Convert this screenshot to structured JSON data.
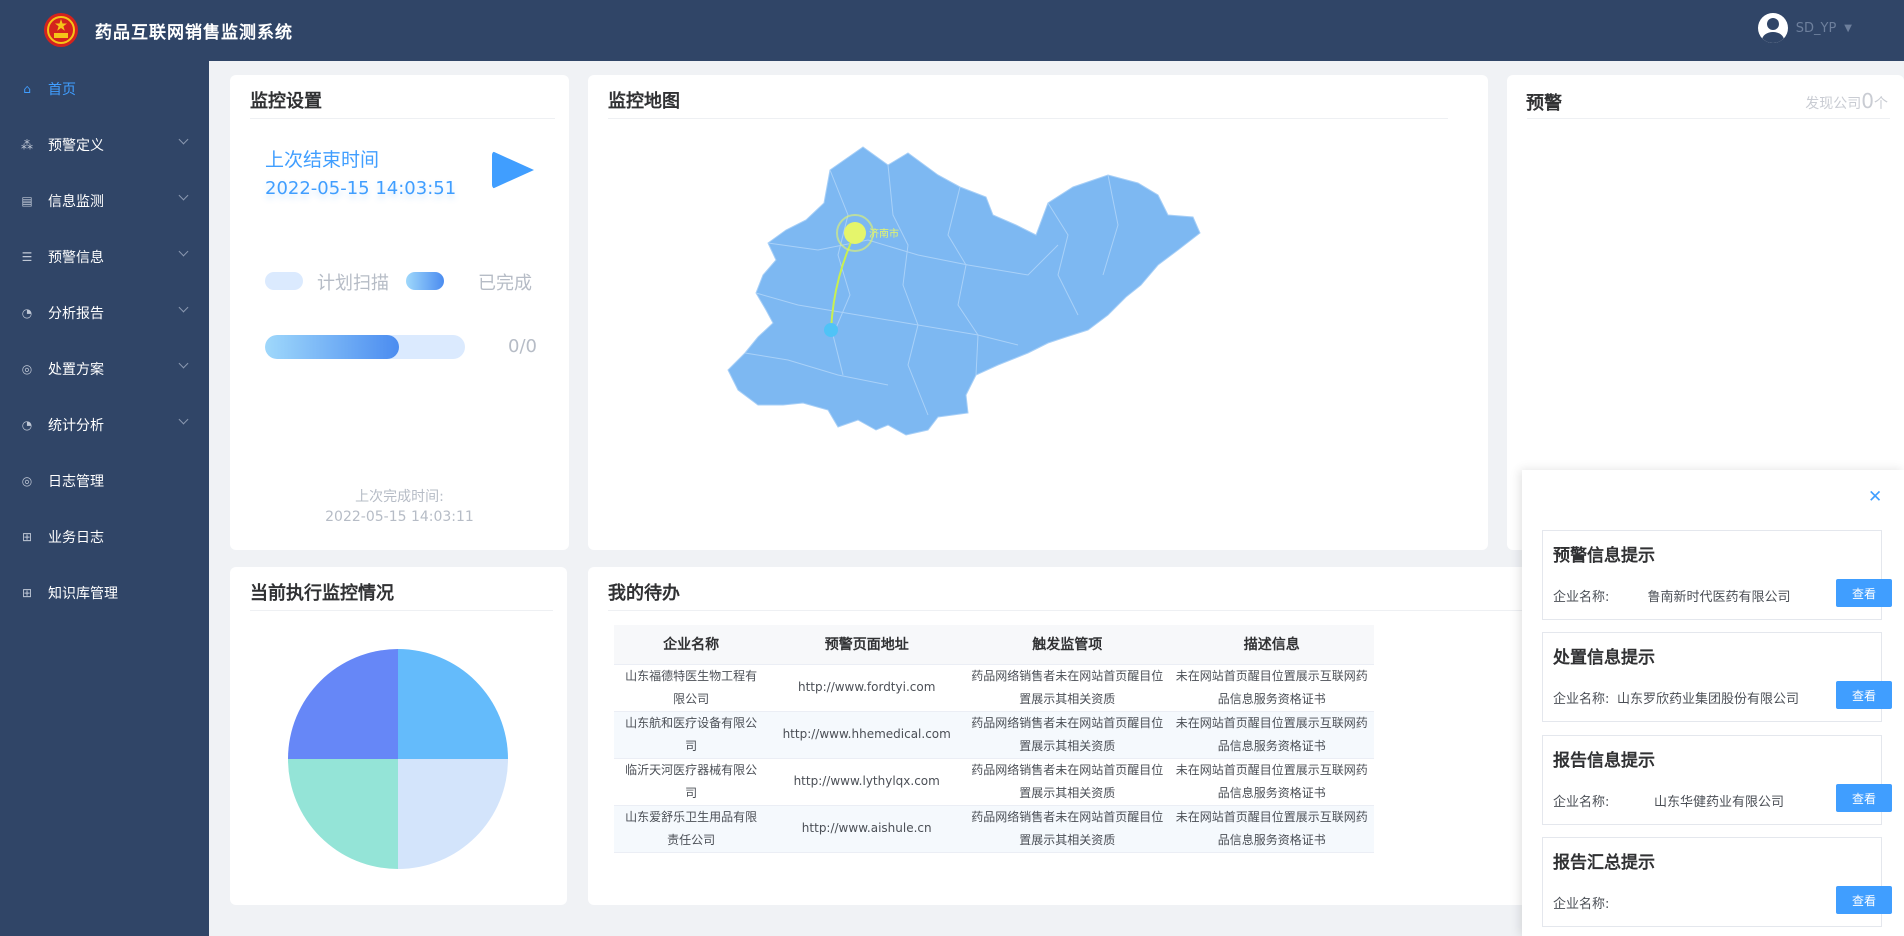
{
  "header": {
    "title": "药品互联网销售监测系统",
    "username": "SD_YP"
  },
  "sidebar": {
    "items": [
      {
        "label": "首页",
        "icon": "home-icon"
      },
      {
        "label": "预警定义",
        "icon": "nodes-icon"
      },
      {
        "label": "信息监测",
        "icon": "document-icon"
      },
      {
        "label": "预警信息",
        "icon": "list-icon"
      },
      {
        "label": "分析报告",
        "icon": "pie-icon"
      },
      {
        "label": "处置方案",
        "icon": "badge-icon"
      },
      {
        "label": "统计分析",
        "icon": "chart-icon"
      },
      {
        "label": "日志管理",
        "icon": "badge-icon"
      },
      {
        "label": "业务日志",
        "icon": "grid-icon"
      },
      {
        "label": "知识库管理",
        "icon": "grid-icon"
      }
    ]
  },
  "monitor": {
    "title": "监控设置",
    "last_end_label": "上次结束时间",
    "last_end_time": "2022-05-15 14:03:51",
    "planned_label": "计划扫描",
    "done_label": "已完成",
    "progress": 0.67,
    "progress_text": "0/0",
    "last_done_label": "上次完成时间:",
    "last_done_time": "2022-05-15 14:03:11"
  },
  "map": {
    "title": "监控地图"
  },
  "warning": {
    "title": "预警",
    "found_label": "发现公司",
    "found_count": "0",
    "found_unit": "个"
  },
  "execution": {
    "title": "当前执行监控情况"
  },
  "todo": {
    "title": "我的待办",
    "columns": [
      "企业名称",
      "预警页面地址",
      "触发监管项",
      "描述信息"
    ],
    "rows": [
      [
        "山东福德特医生物工程有限公司",
        "http://www.fordtyi.com",
        "药品网络销售者未在网站首页醒目位置展示其相关资质",
        "未在网站首页醒目位置展示互联网药品信息服务资格证书"
      ],
      [
        "山东航和医疗设备有限公司",
        "http://www.hhemedical.com",
        "药品网络销售者未在网站首页醒目位置展示其相关资质",
        "未在网站首页醒目位置展示互联网药品信息服务资格证书"
      ],
      [
        "临沂天河医疗器械有限公司",
        "http://www.lythylqx.com",
        "药品网络销售者未在网站首页醒目位置展示其相关资质",
        "未在网站首页醒目位置展示互联网药品信息服务资格证书"
      ],
      [
        "山东爱舒乐卫生用品有限责任公司",
        "http://www.aishule.cn",
        "药品网络销售者未在网站首页醒目位置展示其相关资质",
        "未在网站首页醒目位置展示互联网药品信息服务资格证书"
      ]
    ]
  },
  "notices": {
    "company_label": "企业名称:",
    "view_label": "查看",
    "items": [
      {
        "title": "预警信息提示",
        "company": "鲁南新时代医药有限公司"
      },
      {
        "title": "处置信息提示",
        "company": "山东罗欣药业集团股份有限公司"
      },
      {
        "title": "报告信息提示",
        "company": "山东华健药业有限公司"
      },
      {
        "title": "报告汇总提示",
        "company": ""
      }
    ]
  }
}
